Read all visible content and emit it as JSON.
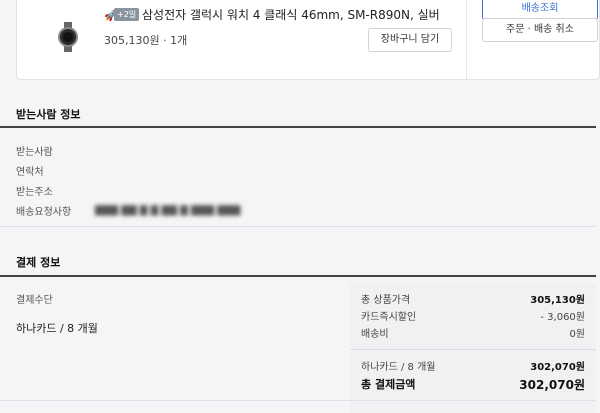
{
  "order_item": {
    "product_name": "삼성전자 갤럭시 워치 4 클래식 46mm, SM-R890N, 실버",
    "badge": "+2일",
    "price_qty": "305,130원 · 1개",
    "cart_button": "장바구니 담기",
    "track_button": "배송조회",
    "cancel_button": "주문 · 배송 취소"
  },
  "recipient": {
    "title": "받는사람 정보",
    "labels": [
      "받는사람",
      "연락처",
      "받는주소",
      "배송요청사항"
    ]
  },
  "payment": {
    "title": "결제 정보",
    "method_label": "결제수단",
    "method_value": "하나카드 / 8 개월",
    "summary": {
      "total_product_label": "총 상품가격",
      "total_product_value": "305,130원",
      "card_discount_label": "카드즉시할인",
      "card_discount_value": "- 3,060원",
      "shipping_label": "배송비",
      "shipping_value": "0원",
      "card_installment_label": "하나카드 / 8 개월",
      "card_installment_value": "302,070원",
      "total_payment_label": "총 결제금액",
      "total_payment_value": "302,070원"
    }
  },
  "colors": {
    "accent": "#3a6fd8",
    "summary_bg": "#f0f1f3"
  }
}
